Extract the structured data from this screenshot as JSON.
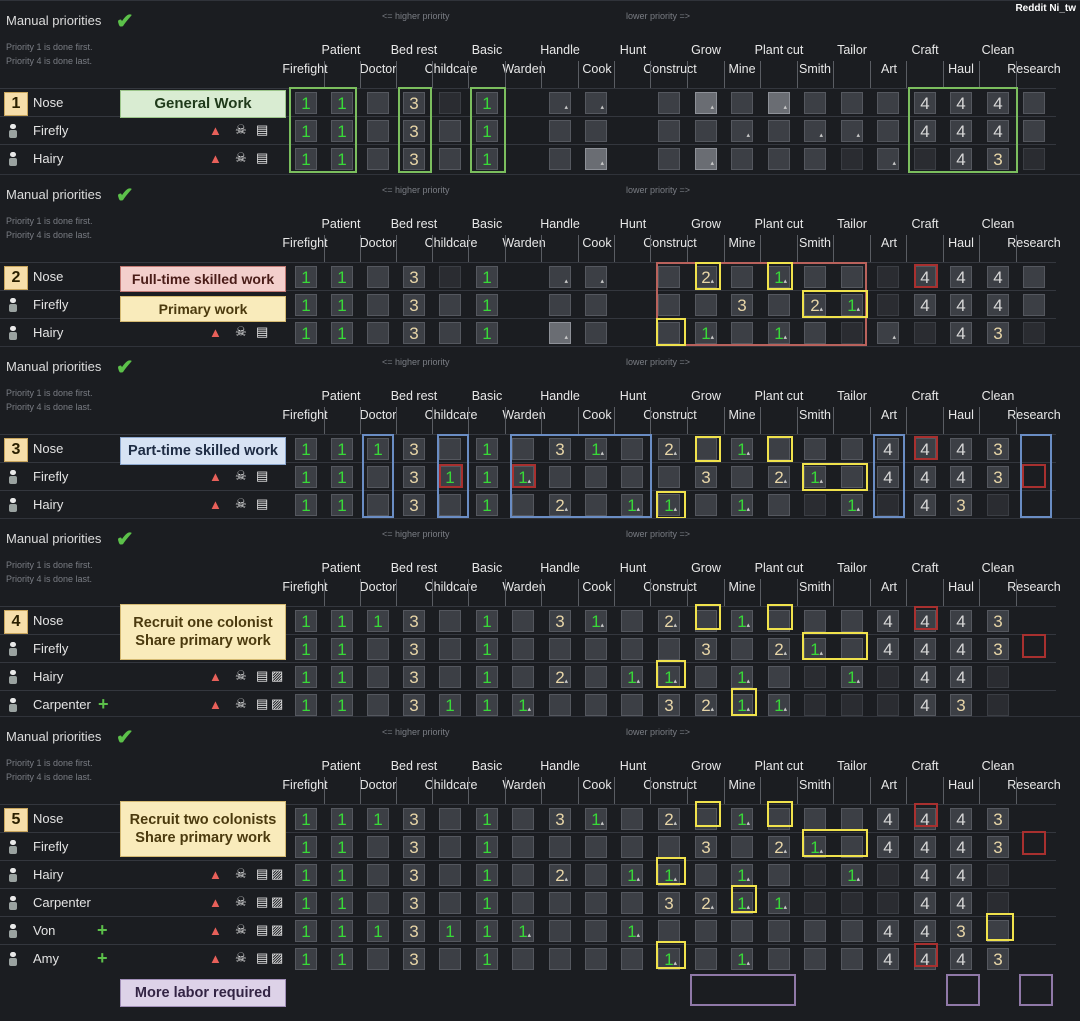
{
  "credit": "Reddit Ni_tw",
  "common": {
    "manual_priorities": "Manual priorities",
    "higher": "<= higher priority",
    "lower": "lower priority =>",
    "note1": "Priority 1 is done first.",
    "note2": "Priority 4 is done last."
  },
  "headers_top": [
    "Patient",
    "Bed rest",
    "Basic",
    "Handle",
    "Hunt",
    "Grow",
    "Plant cut",
    "Tailor",
    "Craft",
    "Clean"
  ],
  "headers_bottom": [
    "Firefight",
    "Doctor",
    "Childcare",
    "Warden",
    "Cook",
    "Construct",
    "Mine",
    "Smith",
    "Art",
    "Haul",
    "Research"
  ],
  "colors": {
    "green": "#38d938",
    "tan": "#e8d6a8",
    "background": "#1b1d21",
    "badge": "#f6deaa",
    "bell": "#e8605a",
    "plus": "#5cc14a"
  },
  "panels": [
    {
      "number": "1",
      "pawns": [
        {
          "name": "Nose",
          "cells": [
            "1",
            "1",
            "e",
            "3",
            "n",
            "1",
            "f",
            "f",
            "e",
            "F",
            "e",
            "F",
            "e",
            "e",
            "e",
            "4",
            "4",
            "4",
            "e"
          ],
          "icons": ""
        },
        {
          "name": "Firefly",
          "cells": [
            "1",
            "1",
            "e",
            "3",
            "e",
            "1",
            "e",
            "e",
            "e",
            "e",
            "f",
            "e",
            "f",
            "f",
            "e",
            "4",
            "4",
            "4",
            "e"
          ],
          "icons": "bsd"
        },
        {
          "name": "Hairy",
          "cells": [
            "1",
            "1",
            "e",
            "3",
            "e",
            "1",
            "e",
            "F",
            "e",
            "F",
            "e",
            "e",
            "e",
            "n",
            "f",
            "n",
            "4",
            "3",
            "n"
          ],
          "icons": "bsd"
        }
      ],
      "labels": [
        {
          "text": "General Work",
          "color": "green"
        }
      ]
    },
    {
      "number": "2",
      "pawns": [
        {
          "name": "Nose",
          "cells": [
            "1",
            "1",
            "e",
            "3",
            "n",
            "1",
            "f",
            "f",
            "e",
            "2",
            "e",
            "1",
            "e",
            "e",
            "n",
            "4",
            "4",
            "4",
            "e"
          ],
          "icons": ""
        },
        {
          "name": "Firefly",
          "cells": [
            "1",
            "1",
            "e",
            "3",
            "e",
            "1",
            "e",
            "e",
            "e",
            "e",
            "3",
            "e",
            "2",
            "1",
            "n",
            "4",
            "4",
            "4",
            "e"
          ],
          "icons": "bsd"
        },
        {
          "name": "Hairy",
          "cells": [
            "1",
            "1",
            "e",
            "3",
            "e",
            "1",
            "F",
            "e",
            "e",
            "1",
            "e",
            "1",
            "e",
            "n",
            "f",
            "n",
            "4",
            "3",
            "n"
          ],
          "icons": "bsd"
        }
      ],
      "labels": [
        {
          "text": "Full-time skilled work",
          "color": "red"
        },
        {
          "text": "Primary work",
          "color": "yellow"
        }
      ]
    },
    {
      "number": "3",
      "pawns": [
        {
          "name": "Nose",
          "cells": [
            "1",
            "1",
            "1",
            "3",
            "e",
            "1",
            "e",
            "3",
            "1",
            "e",
            "2",
            "e",
            "1",
            "e",
            "e",
            "e",
            "4",
            "4",
            "4",
            "3"
          ],
          "icons": ""
        },
        {
          "name": "Firefly",
          "cells": [
            "1",
            "1",
            "e",
            "3",
            "1",
            "1",
            "1",
            "e",
            "e",
            "e",
            "e",
            "3",
            "e",
            "2",
            "1",
            "e",
            "4",
            "4",
            "4",
            "3"
          ],
          "icons": "bsd"
        },
        {
          "name": "Hairy",
          "cells": [
            "1",
            "1",
            "e",
            "3",
            "e",
            "1",
            "e",
            "2",
            "e",
            "1",
            "1",
            "e",
            "1",
            "e",
            "n",
            "1",
            "n",
            "4",
            "3",
            "n"
          ],
          "icons": "bsd"
        }
      ],
      "labels": [
        {
          "text": "Part-time skilled work",
          "color": "blue"
        }
      ]
    },
    {
      "number": "4",
      "pawns": [
        {
          "name": "Nose",
          "cells": [
            "1",
            "1",
            "1",
            "3",
            "e",
            "1",
            "e",
            "3",
            "1",
            "e",
            "2",
            "e",
            "1",
            "e",
            "e",
            "e",
            "4",
            "4",
            "4",
            "3"
          ],
          "icons": ""
        },
        {
          "name": "Firefly",
          "cells": [
            "1",
            "1",
            "e",
            "3",
            "e",
            "1",
            "e",
            "e",
            "e",
            "e",
            "e",
            "3",
            "e",
            "2",
            "1",
            "e",
            "4",
            "4",
            "4",
            "3"
          ],
          "icons": "bsd"
        },
        {
          "name": "Hairy",
          "cells": [
            "1",
            "1",
            "e",
            "3",
            "e",
            "1",
            "e",
            "2",
            "e",
            "1",
            "1",
            "e",
            "1",
            "e",
            "n",
            "1",
            "n",
            "4",
            "4",
            "n"
          ],
          "icons": "bsdr"
        },
        {
          "name": "Carpenter",
          "plus": true,
          "cells": [
            "1",
            "1",
            "e",
            "3",
            "1",
            "1",
            "1",
            "e",
            "e",
            "e",
            "3",
            "2",
            "1",
            "1",
            "n",
            "n",
            "n",
            "4",
            "3",
            "n"
          ],
          "icons": "bsdr"
        }
      ],
      "labels": [
        {
          "text": "Recruit one colonist\nShare primary work",
          "color": "yellow"
        }
      ]
    },
    {
      "number": "5",
      "pawns": [
        {
          "name": "Nose",
          "cells": [
            "1",
            "1",
            "1",
            "3",
            "e",
            "1",
            "e",
            "3",
            "1",
            "e",
            "2",
            "e",
            "1",
            "e",
            "e",
            "e",
            "4",
            "4",
            "4",
            "3"
          ],
          "icons": ""
        },
        {
          "name": "Firefly",
          "cells": [
            "1",
            "1",
            "e",
            "3",
            "e",
            "1",
            "e",
            "e",
            "e",
            "e",
            "e",
            "3",
            "e",
            "2",
            "1",
            "e",
            "4",
            "4",
            "4",
            "3"
          ],
          "icons": "bsd"
        },
        {
          "name": "Hairy",
          "cells": [
            "1",
            "1",
            "e",
            "3",
            "e",
            "1",
            "e",
            "2",
            "e",
            "1",
            "1",
            "e",
            "1",
            "e",
            "n",
            "1",
            "n",
            "4",
            "4",
            "n"
          ],
          "icons": "bsdr"
        },
        {
          "name": "Carpenter",
          "cells": [
            "1",
            "1",
            "e",
            "3",
            "e",
            "1",
            "e",
            "e",
            "e",
            "e",
            "3",
            "2",
            "1",
            "1",
            "n",
            "n",
            "n",
            "4",
            "4",
            "n"
          ],
          "icons": "bsdr"
        },
        {
          "name": "Von",
          "plus": true,
          "cells": [
            "1",
            "1",
            "1",
            "3",
            "1",
            "1",
            "1",
            "e",
            "e",
            "1",
            "e",
            "e",
            "e",
            "e",
            "e",
            "e",
            "4",
            "4",
            "3",
            "e"
          ],
          "icons": "bsdr"
        },
        {
          "name": "Amy",
          "plus": true,
          "cells": [
            "1",
            "1",
            "e",
            "3",
            "e",
            "1",
            "e",
            "e",
            "e",
            "e",
            "1",
            "e",
            "1",
            "e",
            "e",
            "e",
            "4",
            "4",
            "4",
            "3"
          ],
          "icons": "bsdr"
        }
      ],
      "labels": [
        {
          "text": "Recruit two colonists\nShare primary work",
          "color": "yellow"
        },
        {
          "text": "More labor required",
          "color": "purple"
        }
      ]
    }
  ]
}
